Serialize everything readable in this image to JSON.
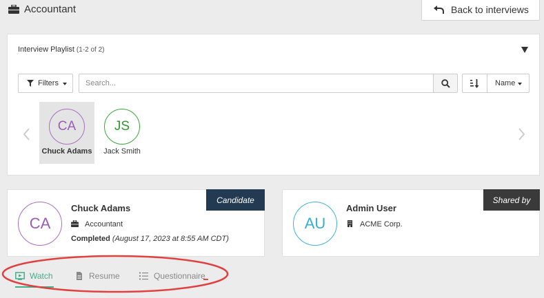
{
  "header": {
    "job_title": "Accountant",
    "back_button_label": "Back to interviews"
  },
  "playlist": {
    "title": "Interview Playlist",
    "count": "(1-2 of 2)",
    "filters_label": "Filters",
    "search_placeholder": "Search...",
    "sort_label": "Name",
    "candidates": [
      {
        "initials": "CA",
        "name": "Chuck Adams",
        "color": "#9a5cb8",
        "selected": true
      },
      {
        "initials": "JS",
        "name": "Jack Smith",
        "color": "#2e9a2e",
        "selected": false
      }
    ]
  },
  "candidate_card": {
    "tag": "Candidate",
    "initials": "CA",
    "name": "Chuck Adams",
    "job": "Accountant",
    "status": "Completed",
    "status_date": "(August 17, 2023 at 8:55 AM CDT)"
  },
  "shared_card": {
    "tag": "Shared by",
    "initials": "AU",
    "name": "Admin User",
    "org": "ACME Corp."
  },
  "tabs": [
    {
      "label": "Watch",
      "active": true
    },
    {
      "label": "Resume",
      "active": false
    },
    {
      "label": "Questionnaire",
      "active": false
    }
  ],
  "colors": {
    "accent_green": "#3fae8a",
    "candidate_tag": "#223a52",
    "shared_tag": "#3a3a3a",
    "annotation_red": "#e04040"
  },
  "icons": [
    "briefcase-icon",
    "undo-arrow-icon",
    "filter-icon",
    "search-icon",
    "sort-icon",
    "chevron-left-icon",
    "chevron-right-icon",
    "building-icon",
    "video-icon",
    "document-icon",
    "list-icon"
  ]
}
